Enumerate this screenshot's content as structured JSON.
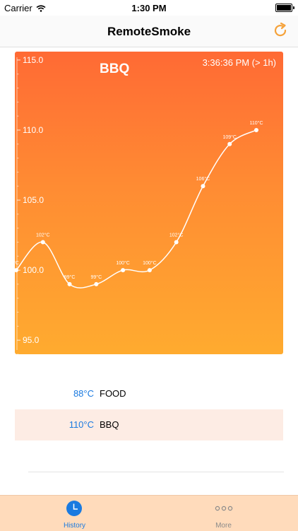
{
  "status_bar": {
    "carrier": "Carrier",
    "time": "1:30 PM"
  },
  "nav": {
    "title": "RemoteSmoke",
    "refresh_icon": "refresh-icon"
  },
  "chart_data": {
    "type": "line",
    "title": "BBQ",
    "timestamp": "3:36:36 PM (> 1h)",
    "ylim": [
      94,
      115.6
    ],
    "y_ticks": [
      "115.0",
      "110.0",
      "105.0",
      "100.0",
      "95.0"
    ],
    "y_tick_values": [
      115,
      110,
      105,
      100,
      95
    ],
    "series": [
      {
        "values": [
          100,
          102,
          99,
          99,
          100,
          100,
          102,
          106,
          109,
          110
        ],
        "labels": [
          "°C",
          "102°C",
          "99°C",
          "99°C",
          "100°C",
          "100°C",
          "102°C",
          "106°C",
          "109°C",
          "110°C"
        ]
      }
    ],
    "line_color": "#ffffff",
    "gradient": [
      "#ff6a34",
      "#ffab2f"
    ]
  },
  "legend": [
    {
      "value": "88°C",
      "name": "FOOD"
    },
    {
      "value": "110°C",
      "name": "BBQ"
    }
  ],
  "tabbar": {
    "history_label": "History",
    "more_label": "More",
    "active_color": "#1a7ae0",
    "inactive_color": "#8a8a8a"
  }
}
